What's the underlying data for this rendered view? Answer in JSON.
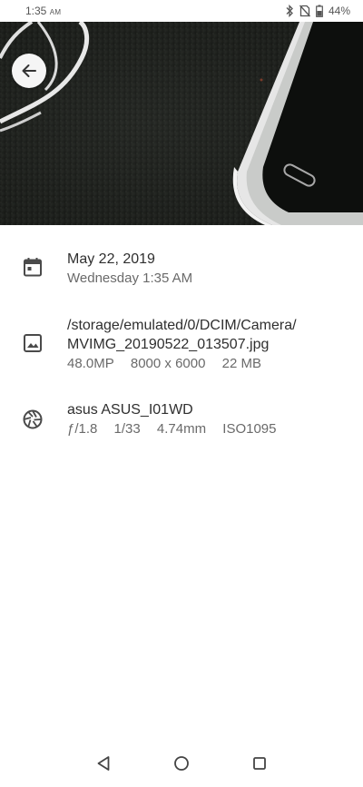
{
  "status_bar": {
    "time": "1:35",
    "ampm": "AM",
    "battery": "44%",
    "icons": [
      "bluetooth-icon",
      "no-sim-icon",
      "battery-icon"
    ]
  },
  "header": {
    "back_icon": "arrow-left-icon"
  },
  "photo": {
    "description_icon": "photo-preview"
  },
  "details": {
    "date": {
      "icon": "calendar-icon",
      "primary": "May 22, 2019",
      "secondary": "Wednesday 1:35 AM"
    },
    "file": {
      "icon": "image-icon",
      "path_line1": "/storage/emulated/0/DCIM/Camera/",
      "path_line2": "MVIMG_20190522_013507.jpg",
      "megapixels": "48.0MP",
      "resolution": "8000 x 6000",
      "size": "22 MB"
    },
    "camera": {
      "icon": "aperture-icon",
      "model": "asus ASUS_I01WD",
      "aperture": "ƒ/1.8",
      "shutter": "1/33",
      "focal_length": "4.74mm",
      "iso": "ISO1095"
    }
  },
  "nav": {
    "back_icon": "nav-back-icon",
    "home_icon": "nav-home-icon",
    "recents_icon": "nav-recents-icon"
  },
  "colors": {
    "text_primary": "#2f2f2f",
    "text_secondary": "#6a6a6a",
    "icon": "#4a4a4a"
  }
}
